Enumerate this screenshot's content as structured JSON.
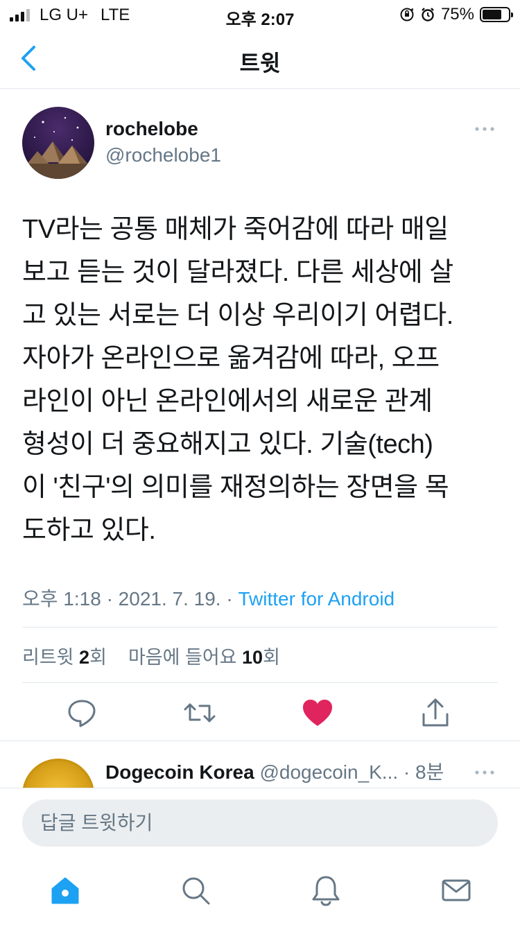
{
  "status_bar": {
    "carrier": "LG U+",
    "network": "LTE",
    "time": "오후 2:07",
    "battery": "75%",
    "battery_level": 0.75
  },
  "nav": {
    "title": "트윗",
    "back_icon": "chevron-left-icon"
  },
  "tweet": {
    "author_name": "rochelobe",
    "author_handle": "@rochelobe1",
    "lines": [
      "TV라는 공통 매체가 죽어감에 따라 매일",
      "보고 듣는 것이 달라졌다. 다른 세상에 살",
      "고 있는 서로는 더 이상 우리이기 어렵다.",
      "자아가 온라인으로 옮겨감에 따라, 오프",
      "라인이 아닌 온라인에서의 새로운 관계",
      "형성이 더 중요해지고 있다. 기술(tech)",
      "이 '친구'의 의미를 재정의하는 장면을 목",
      "도하고 있다."
    ],
    "timestamp": "오후 1:18 · 2021. 7. 19. · ",
    "source": "Twitter for Android",
    "retweet_label": "리트윗",
    "retweet_count": "2",
    "retweet_unit": "회",
    "like_label": "마음에 들어요",
    "like_count": "10",
    "like_unit": "회"
  },
  "actions": {
    "reply_icon": "comment-icon",
    "retweet_icon": "retweet-icon",
    "like_icon": "heart-icon",
    "share_icon": "share-icon",
    "like_color": "#e0245e"
  },
  "reply": {
    "name": "Dogecoin Korea",
    "handle": "@dogecoin_K...",
    "time": " · 8분"
  },
  "composer": {
    "placeholder": "답글 트윗하기"
  },
  "tabbar": {
    "items": [
      {
        "icon": "home-icon",
        "active": true
      },
      {
        "icon": "search-icon",
        "active": false
      },
      {
        "icon": "notifications-icon",
        "active": false
      },
      {
        "icon": "messages-icon",
        "active": false
      }
    ]
  },
  "colors": {
    "accent": "#1da1f2",
    "secondary_text": "#657786",
    "divider": "#e1e8ed"
  }
}
